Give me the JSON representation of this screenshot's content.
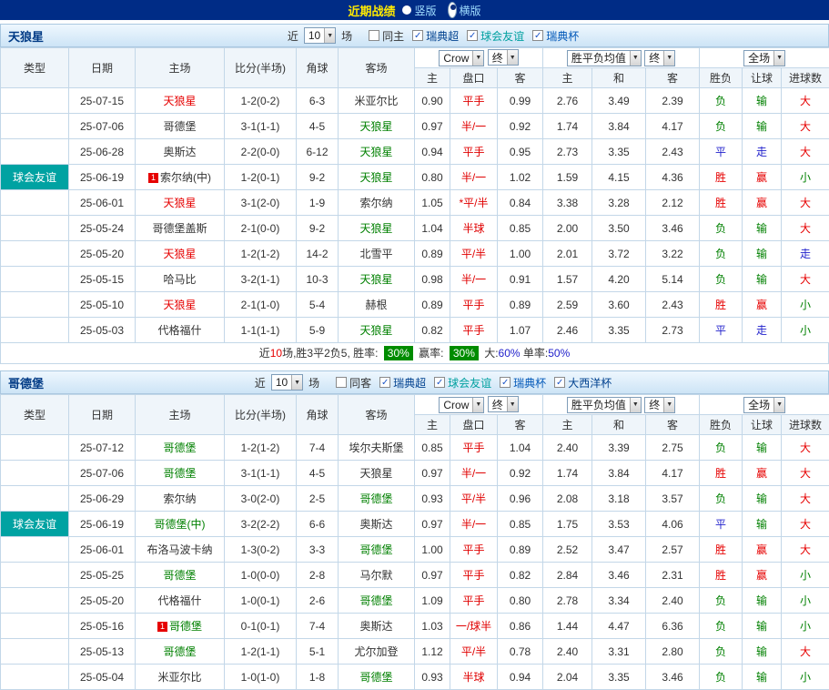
{
  "topbar": {
    "title": "近期战绩",
    "options": [
      {
        "label": "竖版",
        "selected": false
      },
      {
        "label": "横版",
        "selected": true
      }
    ]
  },
  "table_columns": {
    "type": "类型",
    "date": "日期",
    "home": "主场",
    "score": "比分(半场)",
    "corner": "角球",
    "away": "客场",
    "odds_home": "主",
    "handicap": "盘口",
    "odds_away": "客",
    "avg_home": "主",
    "avg_draw": "和",
    "avg_away": "客",
    "result": "胜负",
    "handicap_result": "让球",
    "goals": "进球数"
  },
  "selects": {
    "bookmaker": "Crow",
    "final1": "终",
    "avg": "胜平负均值",
    "final2": "终",
    "scope": "全场"
  },
  "colors": {
    "red": "#e60000",
    "green": "#008000",
    "blue": "#2222cc",
    "black": "#333333"
  },
  "sections": [
    {
      "team": "天狼星",
      "filters": {
        "near": "近",
        "match_count": "10",
        "games": "场",
        "checkboxes": [
          {
            "label": "同主",
            "checked": false,
            "color": "#333333"
          },
          {
            "label": "瑞典超",
            "checked": true,
            "color": "#00418f"
          },
          {
            "label": "球会友谊",
            "checked": true,
            "color": "#00a0a0"
          },
          {
            "label": "瑞典杯",
            "checked": true,
            "color": "#0057b8"
          }
        ]
      },
      "rows": [
        {
          "league": "瑞典超",
          "league_style": "league",
          "date": "25-07-15",
          "home": "天狼星",
          "home_color": "red",
          "home_badge": "",
          "score": "1-2(0-2)",
          "corner": "6-3",
          "away": "米亚尔比",
          "away_color": "black",
          "odds": [
            "0.90",
            "平手",
            "0.99"
          ],
          "avg": [
            "2.76",
            "3.49",
            "2.39"
          ],
          "res": [
            "负",
            "输",
            "大"
          ],
          "res_colors": [
            "green",
            "green",
            "red"
          ]
        },
        {
          "league": "瑞典超",
          "league_style": "league",
          "date": "25-07-06",
          "home": "哥德堡",
          "home_color": "black",
          "home_badge": "",
          "score": "3-1(1-1)",
          "corner": "4-5",
          "away": "天狼星",
          "away_color": "green",
          "odds": [
            "0.97",
            "半/一",
            "0.92"
          ],
          "avg": [
            "1.74",
            "3.84",
            "4.17"
          ],
          "res": [
            "负",
            "输",
            "大"
          ],
          "res_colors": [
            "green",
            "green",
            "red"
          ]
        },
        {
          "league": "瑞典超",
          "league_style": "league",
          "date": "25-06-28",
          "home": "奥斯达",
          "home_color": "black",
          "home_badge": "",
          "score": "2-2(0-0)",
          "corner": "6-12",
          "away": "天狼星",
          "away_color": "green",
          "odds": [
            "0.94",
            "平手",
            "0.95"
          ],
          "avg": [
            "2.73",
            "3.35",
            "2.43"
          ],
          "res": [
            "平",
            "走",
            "大"
          ],
          "res_colors": [
            "blue",
            "blue",
            "red"
          ]
        },
        {
          "league": "球会友谊",
          "league_style": "friendly",
          "date": "25-06-19",
          "home": "索尔纳(中)",
          "home_color": "black",
          "home_badge": "1",
          "score": "1-2(0-1)",
          "corner": "9-2",
          "away": "天狼星",
          "away_color": "green",
          "odds": [
            "0.80",
            "半/一",
            "1.02"
          ],
          "avg": [
            "1.59",
            "4.15",
            "4.36"
          ],
          "res": [
            "胜",
            "赢",
            "小"
          ],
          "res_colors": [
            "red",
            "red",
            "green"
          ]
        },
        {
          "league": "瑞典超",
          "league_style": "league",
          "date": "25-06-01",
          "home": "天狼星",
          "home_color": "red",
          "home_badge": "",
          "score": "3-1(2-0)",
          "corner": "1-9",
          "away": "索尔纳",
          "away_color": "black",
          "odds": [
            "1.05",
            "*平/半",
            "0.84"
          ],
          "avg": [
            "3.38",
            "3.28",
            "2.12"
          ],
          "res": [
            "胜",
            "赢",
            "大"
          ],
          "res_colors": [
            "red",
            "red",
            "red"
          ]
        },
        {
          "league": "瑞典超",
          "league_style": "league",
          "date": "25-05-24",
          "home": "哥德堡盖斯",
          "home_color": "black",
          "home_badge": "",
          "score": "2-1(0-0)",
          "corner": "9-2",
          "away": "天狼星",
          "away_color": "green",
          "odds": [
            "1.04",
            "半球",
            "0.85"
          ],
          "avg": [
            "2.00",
            "3.50",
            "3.46"
          ],
          "res": [
            "负",
            "输",
            "大"
          ],
          "res_colors": [
            "green",
            "green",
            "red"
          ]
        },
        {
          "league": "瑞典超",
          "league_style": "league",
          "date": "25-05-20",
          "home": "天狼星",
          "home_color": "red",
          "home_badge": "",
          "score": "1-2(1-2)",
          "corner": "14-2",
          "away": "北雪平",
          "away_color": "black",
          "odds": [
            "0.89",
            "平/半",
            "1.00"
          ],
          "avg": [
            "2.01",
            "3.72",
            "3.22"
          ],
          "res": [
            "负",
            "输",
            "走"
          ],
          "res_colors": [
            "green",
            "green",
            "blue"
          ]
        },
        {
          "league": "瑞典超",
          "league_style": "league",
          "date": "25-05-15",
          "home": "哈马比",
          "home_color": "black",
          "home_badge": "",
          "score": "3-2(1-1)",
          "corner": "10-3",
          "away": "天狼星",
          "away_color": "green",
          "odds": [
            "0.98",
            "半/一",
            "0.91"
          ],
          "avg": [
            "1.57",
            "4.20",
            "5.14"
          ],
          "res": [
            "负",
            "输",
            "大"
          ],
          "res_colors": [
            "green",
            "green",
            "red"
          ]
        },
        {
          "league": "瑞典超",
          "league_style": "league",
          "date": "25-05-10",
          "home": "天狼星",
          "home_color": "red",
          "home_badge": "",
          "score": "2-1(1-0)",
          "corner": "5-4",
          "away": "赫根",
          "away_color": "black",
          "odds": [
            "0.89",
            "平手",
            "0.89"
          ],
          "avg": [
            "2.59",
            "3.60",
            "2.43"
          ],
          "res": [
            "胜",
            "赢",
            "小"
          ],
          "res_colors": [
            "red",
            "red",
            "green"
          ]
        },
        {
          "league": "瑞典超",
          "league_style": "league",
          "date": "25-05-03",
          "home": "代格福什",
          "home_color": "black",
          "home_badge": "",
          "score": "1-1(1-1)",
          "corner": "5-9",
          "away": "天狼星",
          "away_color": "green",
          "odds": [
            "0.82",
            "平手",
            "1.07"
          ],
          "avg": [
            "2.46",
            "3.35",
            "2.73"
          ],
          "res": [
            "平",
            "走",
            "小"
          ],
          "res_colors": [
            "blue",
            "blue",
            "green"
          ]
        }
      ],
      "summary_parts": [
        {
          "text": "近",
          "color": "black"
        },
        {
          "text": "10",
          "color": "red"
        },
        {
          "text": "场,胜3平2负5, 胜率: ",
          "color": "black"
        },
        {
          "text": "30%",
          "badge": true
        },
        {
          "text": " 赢率: ",
          "color": "black"
        },
        {
          "text": "30%",
          "badge": true
        },
        {
          "text": " 大:",
          "color": "black"
        },
        {
          "text": "60%",
          "color": "blue"
        },
        {
          "text": " 单率:",
          "color": "black"
        },
        {
          "text": "50%",
          "color": "blue"
        }
      ]
    },
    {
      "team": "哥德堡",
      "filters": {
        "near": "近",
        "match_count": "10",
        "games": "场",
        "checkboxes": [
          {
            "label": "同客",
            "checked": false,
            "color": "#333333"
          },
          {
            "label": "瑞典超",
            "checked": true,
            "color": "#00418f"
          },
          {
            "label": "球会友谊",
            "checked": true,
            "color": "#00a0a0"
          },
          {
            "label": "瑞典杯",
            "checked": true,
            "color": "#0057b8"
          },
          {
            "label": "大西洋杯",
            "checked": true,
            "color": "#00418f"
          }
        ]
      },
      "rows": [
        {
          "league": "瑞典超",
          "league_style": "league",
          "date": "25-07-12",
          "home": "哥德堡",
          "home_color": "green",
          "home_badge": "",
          "score": "1-2(1-2)",
          "corner": "7-4",
          "away": "埃尔夫斯堡",
          "away_color": "black",
          "odds": [
            "0.85",
            "平手",
            "1.04"
          ],
          "avg": [
            "2.40",
            "3.39",
            "2.75"
          ],
          "res": [
            "负",
            "输",
            "大"
          ],
          "res_colors": [
            "green",
            "green",
            "red"
          ]
        },
        {
          "league": "瑞典超",
          "league_style": "league",
          "date": "25-07-06",
          "home": "哥德堡",
          "home_color": "green",
          "home_badge": "",
          "score": "3-1(1-1)",
          "corner": "4-5",
          "away": "天狼星",
          "away_color": "black",
          "odds": [
            "0.97",
            "半/一",
            "0.92"
          ],
          "avg": [
            "1.74",
            "3.84",
            "4.17"
          ],
          "res": [
            "胜",
            "赢",
            "大"
          ],
          "res_colors": [
            "red",
            "red",
            "red"
          ]
        },
        {
          "league": "瑞典超",
          "league_style": "league",
          "date": "25-06-29",
          "home": "索尔纳",
          "home_color": "black",
          "home_badge": "",
          "score": "3-0(2-0)",
          "corner": "2-5",
          "away": "哥德堡",
          "away_color": "green",
          "odds": [
            "0.93",
            "平/半",
            "0.96"
          ],
          "avg": [
            "2.08",
            "3.18",
            "3.57"
          ],
          "res": [
            "负",
            "输",
            "大"
          ],
          "res_colors": [
            "green",
            "green",
            "red"
          ]
        },
        {
          "league": "球会友谊",
          "league_style": "friendly",
          "date": "25-06-19",
          "home": "哥德堡(中)",
          "home_color": "green",
          "home_badge": "",
          "score": "3-2(2-2)",
          "corner": "6-6",
          "away": "奥斯达",
          "away_color": "black",
          "odds": [
            "0.97",
            "半/一",
            "0.85"
          ],
          "avg": [
            "1.75",
            "3.53",
            "4.06"
          ],
          "res": [
            "平",
            "输",
            "大"
          ],
          "res_colors": [
            "blue",
            "green",
            "red"
          ]
        },
        {
          "league": "瑞典超",
          "league_style": "league",
          "date": "25-06-01",
          "home": "布洛马波卡纳",
          "home_color": "black",
          "home_badge": "",
          "score": "1-3(0-2)",
          "corner": "3-3",
          "away": "哥德堡",
          "away_color": "green",
          "odds": [
            "1.00",
            "平手",
            "0.89"
          ],
          "avg": [
            "2.52",
            "3.47",
            "2.57"
          ],
          "res": [
            "胜",
            "赢",
            "大"
          ],
          "res_colors": [
            "red",
            "red",
            "red"
          ]
        },
        {
          "league": "瑞典超",
          "league_style": "league",
          "date": "25-05-25",
          "home": "哥德堡",
          "home_color": "green",
          "home_badge": "",
          "score": "1-0(0-0)",
          "corner": "2-8",
          "away": "马尔默",
          "away_color": "black",
          "odds": [
            "0.97",
            "平手",
            "0.82"
          ],
          "avg": [
            "2.84",
            "3.46",
            "2.31"
          ],
          "res": [
            "胜",
            "赢",
            "小"
          ],
          "res_colors": [
            "red",
            "red",
            "green"
          ]
        },
        {
          "league": "瑞典超",
          "league_style": "league",
          "date": "25-05-20",
          "home": "代格福什",
          "home_color": "black",
          "home_badge": "",
          "score": "1-0(0-1)",
          "corner": "2-6",
          "away": "哥德堡",
          "away_color": "green",
          "odds": [
            "1.09",
            "平手",
            "0.80"
          ],
          "avg": [
            "2.78",
            "3.34",
            "2.40"
          ],
          "res": [
            "负",
            "输",
            "小"
          ],
          "res_colors": [
            "green",
            "green",
            "green"
          ]
        },
        {
          "league": "瑞典超",
          "league_style": "league",
          "date": "25-05-16",
          "home": "哥德堡",
          "home_color": "green",
          "home_badge": "1",
          "score": "0-1(0-1)",
          "corner": "7-4",
          "away": "奥斯达",
          "away_color": "black",
          "odds": [
            "1.03",
            "一/球半",
            "0.86"
          ],
          "avg": [
            "1.44",
            "4.47",
            "6.36"
          ],
          "res": [
            "负",
            "输",
            "小"
          ],
          "res_colors": [
            "green",
            "green",
            "green"
          ]
        },
        {
          "league": "瑞典超",
          "league_style": "league",
          "date": "25-05-13",
          "home": "哥德堡",
          "home_color": "green",
          "home_badge": "",
          "score": "1-2(1-1)",
          "corner": "5-1",
          "away": "尤尔加登",
          "away_color": "black",
          "odds": [
            "1.12",
            "平/半",
            "0.78"
          ],
          "avg": [
            "2.40",
            "3.31",
            "2.80"
          ],
          "res": [
            "负",
            "输",
            "大"
          ],
          "res_colors": [
            "green",
            "green",
            "red"
          ]
        },
        {
          "league": "瑞典超",
          "league_style": "league",
          "date": "25-05-04",
          "home": "米亚尔比",
          "home_color": "black",
          "home_badge": "",
          "score": "1-0(1-0)",
          "corner": "1-8",
          "away": "哥德堡",
          "away_color": "green",
          "odds": [
            "0.93",
            "半球",
            "0.94"
          ],
          "avg": [
            "2.04",
            "3.35",
            "3.46"
          ],
          "res": [
            "负",
            "输",
            "小"
          ],
          "res_colors": [
            "green",
            "green",
            "green"
          ]
        }
      ]
    }
  ]
}
